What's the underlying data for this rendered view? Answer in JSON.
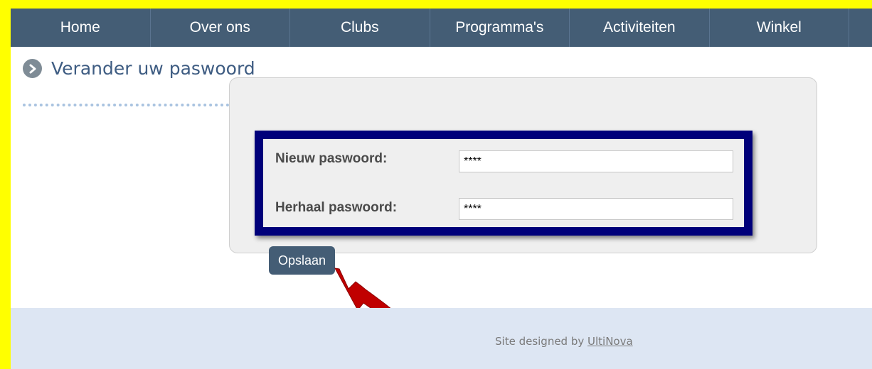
{
  "nav": {
    "items": [
      {
        "label": "Home"
      },
      {
        "label": "Over ons"
      },
      {
        "label": "Clubs"
      },
      {
        "label": "Programma's"
      },
      {
        "label": "Activiteiten"
      },
      {
        "label": "Winkel"
      }
    ]
  },
  "page": {
    "title": "Verander uw paswoord",
    "title_icon": "arrow-right-circle-icon"
  },
  "form": {
    "new_password_label": "Nieuw paswoord:",
    "new_password_value": "****",
    "repeat_password_label": "Herhaal paswoord:",
    "repeat_password_value": "****",
    "save_label": "Opslaan"
  },
  "footer": {
    "prefix": "Site designed by ",
    "link": "UltiNova"
  },
  "annotations": {
    "highlight_color": "#00007a",
    "arrow_color": "#c00000"
  },
  "colors": {
    "nav_bg": "#445d75",
    "accent_title": "#3e5c82",
    "footer_bg": "#dde6f3",
    "border_yellow": "#ffff00"
  }
}
